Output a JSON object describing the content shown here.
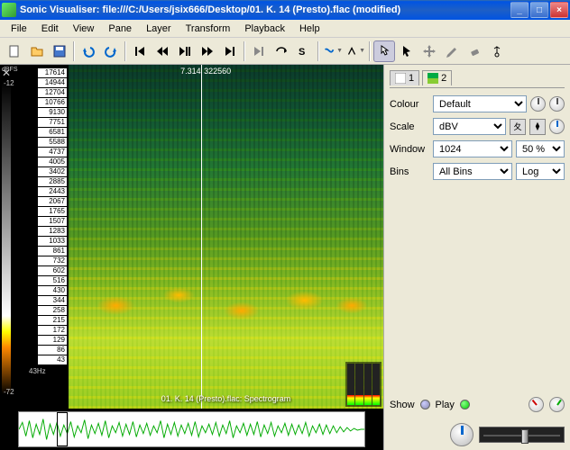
{
  "title": "Sonic Visualiser: file:///C:/Users/jsix666/Desktop/01. K. 14 (Presto).flac (modified)",
  "menu": [
    "File",
    "Edit",
    "View",
    "Pane",
    "Layer",
    "Transform",
    "Playback",
    "Help"
  ],
  "time": {
    "pos": "7.314",
    "frame": "322560"
  },
  "spectrogram_caption": "01. K. 14 (Presto).flac: Spectrogram",
  "db": {
    "unit": "dBFS",
    "min": "-72",
    "max": "-12"
  },
  "freq_unit": "43Hz",
  "freqs": [
    "17614",
    "14944",
    "12704",
    "10766",
    "9130",
    "7751",
    "6581",
    "5588",
    "4737",
    "4005",
    "3402",
    "2885",
    "2443",
    "2067",
    "1765",
    "1507",
    "1283",
    "1033",
    "861",
    "732",
    "602",
    "516",
    "430",
    "344",
    "258",
    "215",
    "172",
    "129",
    "86",
    "43"
  ],
  "tabs": {
    "t1": "1",
    "t2": "2"
  },
  "props": {
    "colour_label": "Colour",
    "colour_value": "Default",
    "scale_label": "Scale",
    "scale_value": "dBV",
    "window_label": "Window",
    "window_value": "1024",
    "overlap_value": "50 %",
    "bins_label": "Bins",
    "bins_value": "All Bins",
    "bins_scale": "Log"
  },
  "showplay": {
    "show": "Show",
    "play": "Play"
  }
}
